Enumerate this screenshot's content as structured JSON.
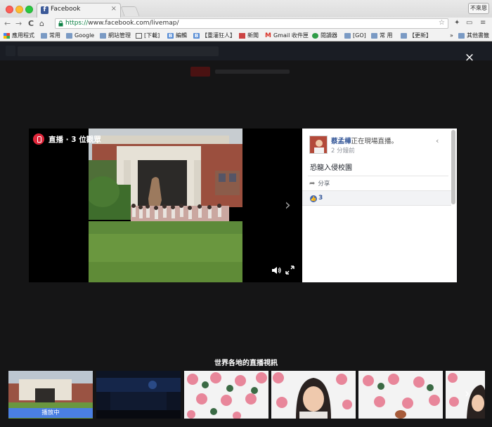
{
  "browser": {
    "tab_title": "Facebook",
    "tab_close": "×",
    "profile_button": "不來恩",
    "url_scheme": "https://",
    "url_rest": "www.facebook.com/livemap/",
    "nav": {
      "back": "←",
      "forward": "→",
      "reload": "C",
      "home": "⌂"
    }
  },
  "bookmarks": [
    {
      "label": "應用程式",
      "icon": "apps-grid-icon"
    },
    {
      "label": "常用",
      "icon": "folder-icon"
    },
    {
      "label": "Google",
      "icon": "folder-icon"
    },
    {
      "label": "網站管理",
      "icon": "folder-icon"
    },
    {
      "label": "[下載]",
      "icon": "download-icon"
    },
    {
      "label": "編輯",
      "icon": "blogger-icon"
    },
    {
      "label": "【重灌狂人】",
      "icon": "blogger-icon"
    },
    {
      "label": "新聞",
      "icon": "news-icon"
    },
    {
      "label": "Gmail 收件匣",
      "icon": "gmail-icon"
    },
    {
      "label": "閱讀器",
      "icon": "reader-icon"
    },
    {
      "label": "[GO]",
      "icon": "folder-icon"
    },
    {
      "label": "常 用",
      "icon": "folder-icon"
    },
    {
      "label": "【更新】",
      "icon": "folder-icon"
    }
  ],
  "bookmarks_more": "»",
  "other_bookmarks": "其他書籤",
  "viewer": {
    "live_label": "直播 · 3 位觀眾",
    "close": "×",
    "next": "›"
  },
  "post": {
    "author": "蔡孟樺",
    "status": "正在現場直播。",
    "time": "2 分鐘前",
    "message": "恐龍入侵校園",
    "share": "分享",
    "likes": "3",
    "chevron": "‹"
  },
  "strip": {
    "title": "世界各地的直播視訊",
    "playing_label": "播放中",
    "next": "›"
  }
}
